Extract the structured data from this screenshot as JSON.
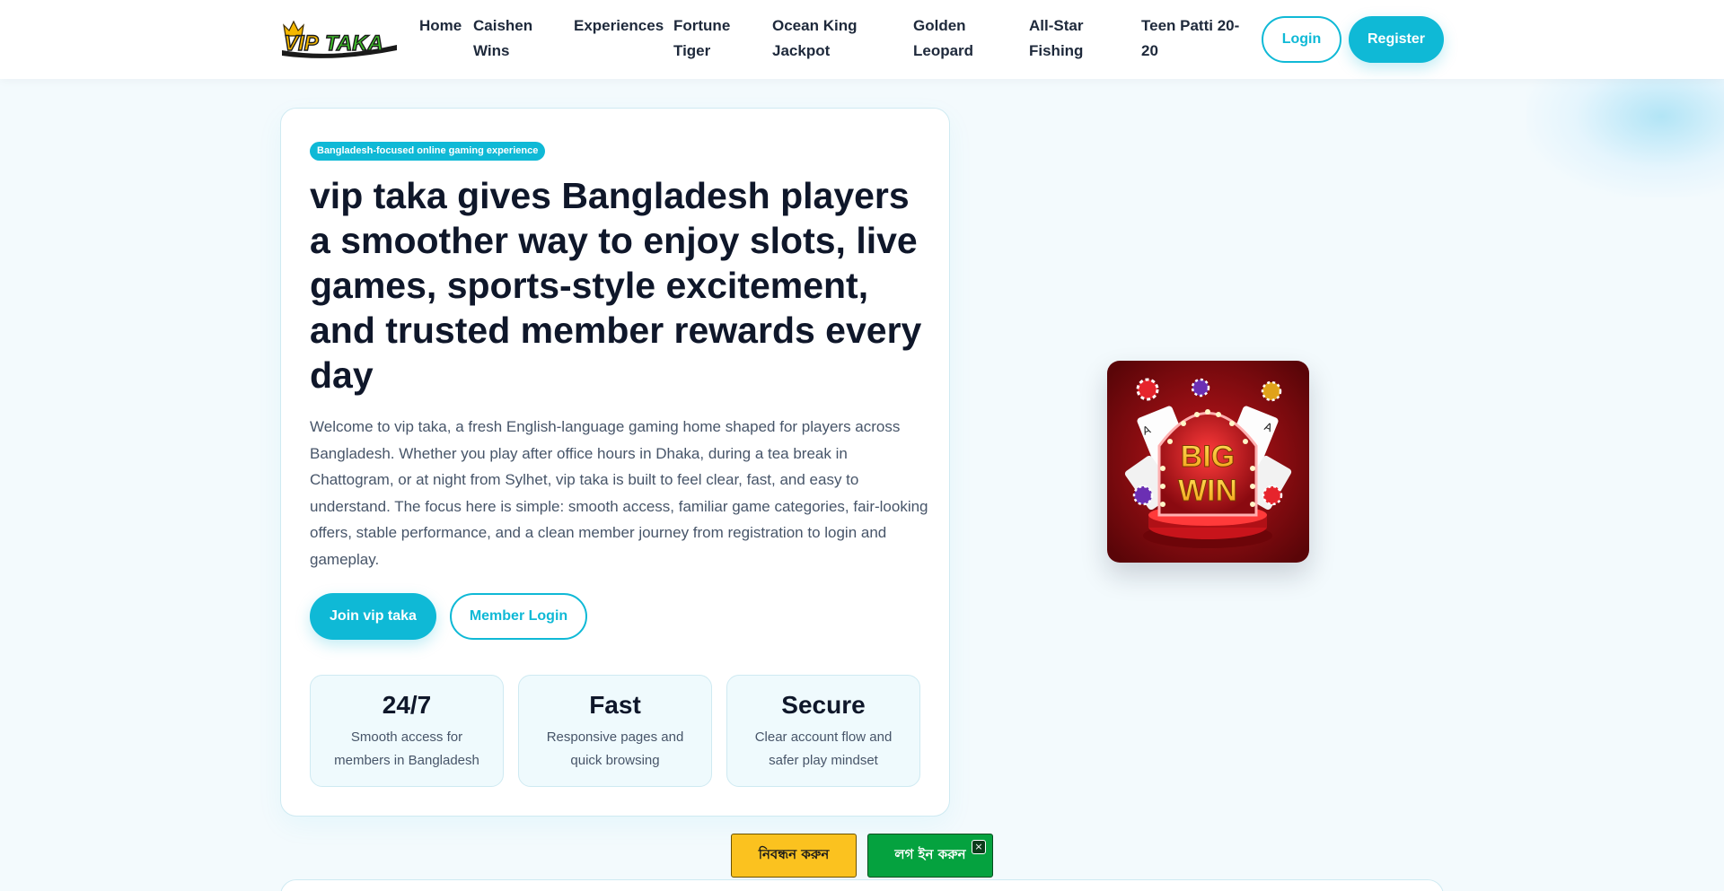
{
  "header": {
    "logo_text": "VIPTAKA",
    "nav": [
      {
        "label": "Home"
      },
      {
        "label": "Caishen Wins"
      },
      {
        "label": "Experiences"
      },
      {
        "label": "Fortune Tiger"
      },
      {
        "label": "Ocean King Jackpot"
      },
      {
        "label": "Golden Leopard"
      },
      {
        "label": "All-Star Fishing"
      },
      {
        "label": "Teen Patti 20-20"
      }
    ],
    "login_label": "Login",
    "register_label": "Register"
  },
  "hero": {
    "badge": "Bangladesh-focused online gaming experience",
    "title": "vip taka gives Bangladesh players a smoother way to enjoy slots, live games, sports-style excitement, and trusted member rewards every day",
    "description": "Welcome to vip taka, a fresh English-language gaming home shaped for players across Bangladesh. Whether you play after office hours in Dhaka, during a tea break in Chattogram, or at night from Sylhet, vip taka is built to feel clear, fast, and easy to understand. The focus here is simple: smooth access, familiar game categories, fair-looking offers, stable performance, and a clean member journey from registration to login and gameplay.",
    "join_label": "Join vip taka",
    "member_login_label": "Member Login",
    "stats": [
      {
        "value": "24/7",
        "label": "Smooth access for members in Bangladesh"
      },
      {
        "value": "Fast",
        "label": "Responsive pages and quick browsing"
      },
      {
        "value": "Secure",
        "label": "Clear account flow and safer play mindset"
      }
    ]
  },
  "promo_image": {
    "text_line1": "BIG",
    "text_line2": "WIN"
  },
  "sticky": {
    "register_label": "নিবন্ধন করুন",
    "login_label": "লগ ইন করুন",
    "close_label": "×"
  },
  "colors": {
    "accent": "#0fb9d6",
    "heading": "#0f172a",
    "sticky_register": "#fbc21f",
    "sticky_login": "#05a23f"
  }
}
